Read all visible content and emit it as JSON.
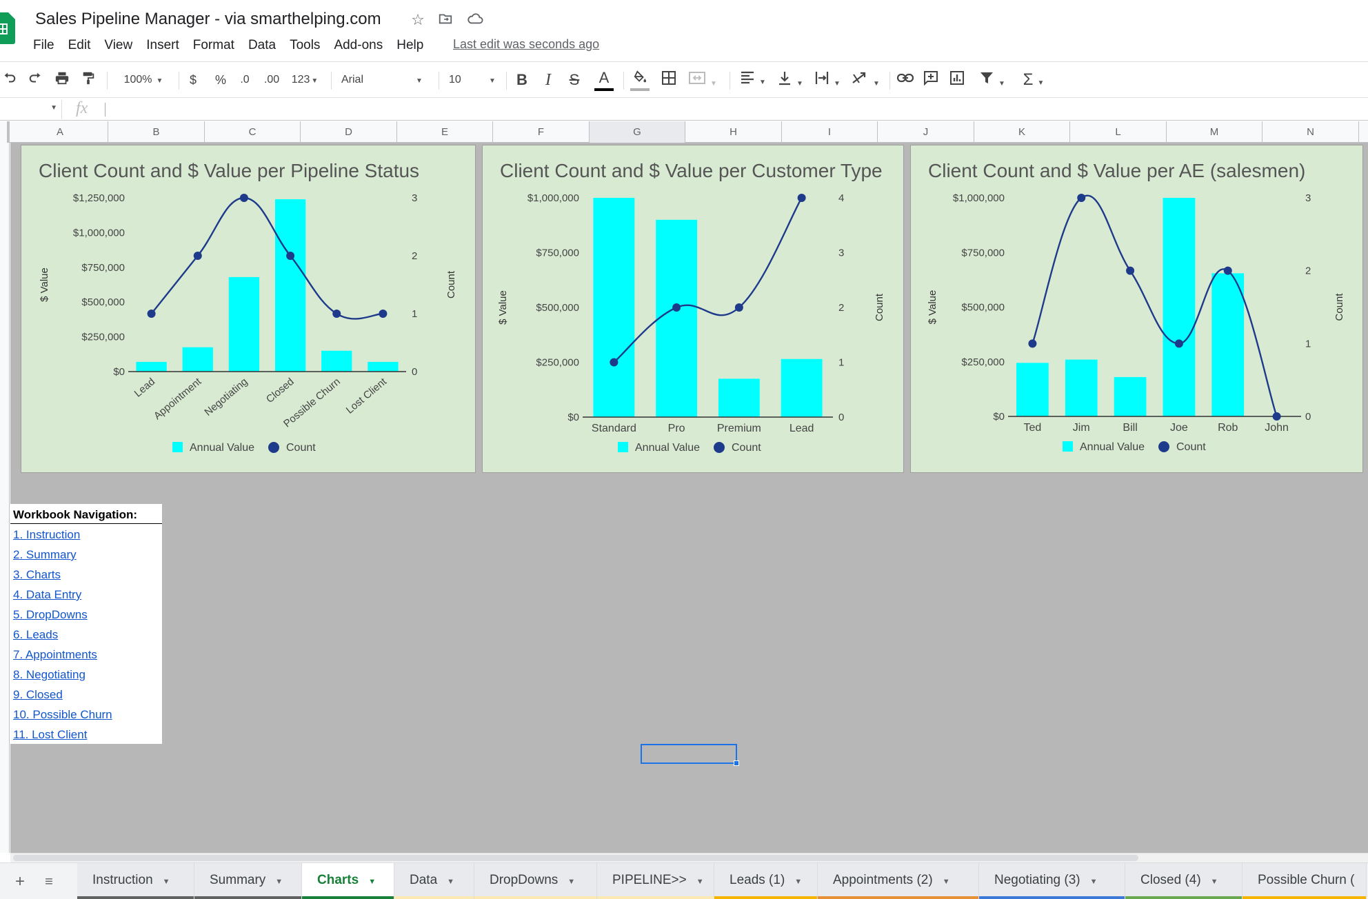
{
  "app": {
    "title": "Sales Pipeline Manager - via smarthelping.com",
    "last_edit": "Last edit was seconds ago",
    "menu": [
      "File",
      "Edit",
      "View",
      "Insert",
      "Format",
      "Data",
      "Tools",
      "Add-ons",
      "Help"
    ]
  },
  "toolbar": {
    "zoom": "100%",
    "currency": "$",
    "percent": "%",
    "dec_decrease": ".0",
    "dec_increase": ".00",
    "more_formats": "123",
    "font": "Arial",
    "font_size": "10",
    "bold": "B",
    "italic": "I",
    "strike": "S",
    "text_color": "A"
  },
  "formula_bar": {
    "fx": "fx"
  },
  "columns": [
    "A",
    "B",
    "C",
    "D",
    "E",
    "F",
    "G",
    "H",
    "I",
    "J",
    "K",
    "L",
    "M",
    "N"
  ],
  "selected_column": "G",
  "colors": {
    "bar": "#00ffff",
    "line": "#1e3a8a",
    "chart_bg": "#d9ead3",
    "grid_bg": "#b7b7b7"
  },
  "chart_data": [
    {
      "type": "bar",
      "title": "Client Count and $ Value per Pipeline Status",
      "categories": [
        "Lead",
        "Appointment",
        "Negotiating",
        "Closed",
        "Possible Churn",
        "Lost Client"
      ],
      "series": [
        {
          "name": "Annual Value",
          "type": "bar",
          "axis": "left",
          "values": [
            70000,
            175000,
            680000,
            1240000,
            150000,
            70000
          ]
        },
        {
          "name": "Count",
          "type": "line",
          "axis": "right",
          "values": [
            1,
            2,
            3,
            2,
            1,
            1
          ]
        }
      ],
      "ylabel": "$ Value",
      "y2label": "Count",
      "yticks": [
        "$0",
        "$250,000",
        "$500,000",
        "$750,000",
        "$1,000,000",
        "$1,250,000"
      ],
      "y2ticks": [
        "0",
        "1",
        "2",
        "3"
      ],
      "ylim": [
        0,
        1250000
      ],
      "y2lim": [
        0,
        3
      ],
      "rotate_labels": true,
      "legend": "bottom"
    },
    {
      "type": "bar",
      "title": "Client Count and $ Value per Customer Type",
      "categories": [
        "Standard",
        "Pro",
        "Premium",
        "Lead"
      ],
      "series": [
        {
          "name": "Annual Value",
          "type": "bar",
          "axis": "left",
          "values": [
            1000000,
            900000,
            175000,
            265000
          ]
        },
        {
          "name": "Count",
          "type": "line",
          "axis": "right",
          "values": [
            1,
            2,
            2,
            4
          ]
        }
      ],
      "ylabel": "$ Value",
      "y2label": "Count",
      "yticks": [
        "$0",
        "$250,000",
        "$500,000",
        "$750,000",
        "$1,000,000"
      ],
      "y2ticks": [
        "0",
        "1",
        "2",
        "3",
        "4"
      ],
      "ylim": [
        0,
        1000000
      ],
      "y2lim": [
        0,
        4
      ],
      "rotate_labels": false,
      "legend": "bottom"
    },
    {
      "type": "bar",
      "title": "Client Count and $ Value per AE (salesmen)",
      "categories": [
        "Ted",
        "Jim",
        "Bill",
        "Joe",
        "Rob",
        "John"
      ],
      "series": [
        {
          "name": "Annual Value",
          "type": "bar",
          "axis": "left",
          "values": [
            245000,
            260000,
            180000,
            1000000,
            655000,
            0
          ]
        },
        {
          "name": "Count",
          "type": "line",
          "axis": "right",
          "values": [
            1,
            3,
            2,
            1,
            2,
            0
          ]
        }
      ],
      "ylabel": "$ Value",
      "y2label": "Count",
      "yticks": [
        "$0",
        "$250,000",
        "$500,000",
        "$750,000",
        "$1,000,000"
      ],
      "y2ticks": [
        "0",
        "1",
        "2",
        "3"
      ],
      "ylim": [
        0,
        1000000
      ],
      "y2lim": [
        0,
        3
      ],
      "rotate_labels": false,
      "legend": "bottom"
    }
  ],
  "navigation": {
    "title": "Workbook Navigation:",
    "links": [
      "1. Instruction",
      "2. Summary",
      "3. Charts",
      "4. Data Entry",
      "5. DropDowns",
      "6. Leads",
      "7. Appointments",
      "8. Negotiating",
      "9. Closed",
      "10. Possible Churn",
      "11. Lost Client"
    ]
  },
  "sheet_tabs": [
    {
      "label": "Instruction",
      "color": "#616161",
      "active": false
    },
    {
      "label": "Summary",
      "color": "#616161",
      "active": false
    },
    {
      "label": "Charts",
      "color": "#188038",
      "active": true
    },
    {
      "label": "Data",
      "color": "#fce8b2",
      "active": false
    },
    {
      "label": "DropDowns",
      "color": "#fce8b2",
      "active": false
    },
    {
      "label": "PIPELINE>>",
      "color": "#fce8b2",
      "active": false
    },
    {
      "label": "Leads (1)",
      "color": "#f4b400",
      "active": false
    },
    {
      "label": "Appointments (2)",
      "color": "#e69138",
      "active": false
    },
    {
      "label": "Negotiating (3)",
      "color": "#3c78d8",
      "active": false
    },
    {
      "label": "Closed (4)",
      "color": "#6aa84f",
      "active": false
    },
    {
      "label": "Possible Churn (",
      "color": "#f4b400",
      "active": false
    }
  ]
}
